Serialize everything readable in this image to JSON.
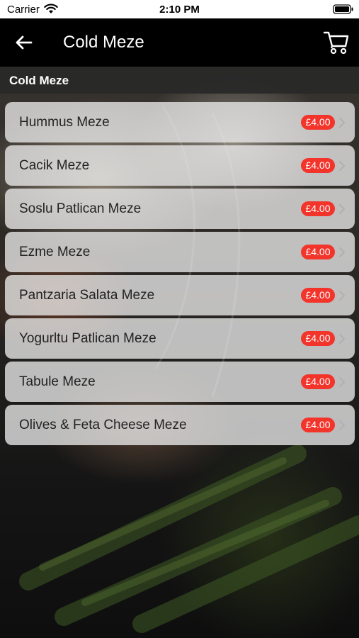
{
  "status_bar": {
    "carrier": "Carrier",
    "time": "2:10 PM",
    "icons": [
      "wifi-icon",
      "battery-icon"
    ]
  },
  "nav": {
    "title": "Cold Meze",
    "icons": [
      "back-arrow-icon",
      "cart-icon"
    ]
  },
  "section": {
    "title": "Cold Meze"
  },
  "colors": {
    "nav_background": "#000000",
    "price_badge": "#f2342b",
    "item_text": "#222222",
    "card_background": "#ebebeb"
  },
  "items": [
    {
      "name": "Hummus Meze",
      "price": "£4.00"
    },
    {
      "name": "Cacik Meze",
      "price": "£4.00"
    },
    {
      "name": "Soslu Patlican Meze",
      "price": "£4.00"
    },
    {
      "name": "Ezme Meze",
      "price": "£4.00"
    },
    {
      "name": "Pantzaria Salata Meze",
      "price": "£4.00"
    },
    {
      "name": "Yogurltu Patlican Meze",
      "price": "£4.00"
    },
    {
      "name": "Tabule Meze",
      "price": "£4.00"
    },
    {
      "name": "Olives & Feta Cheese Meze",
      "price": "£4.00"
    }
  ]
}
